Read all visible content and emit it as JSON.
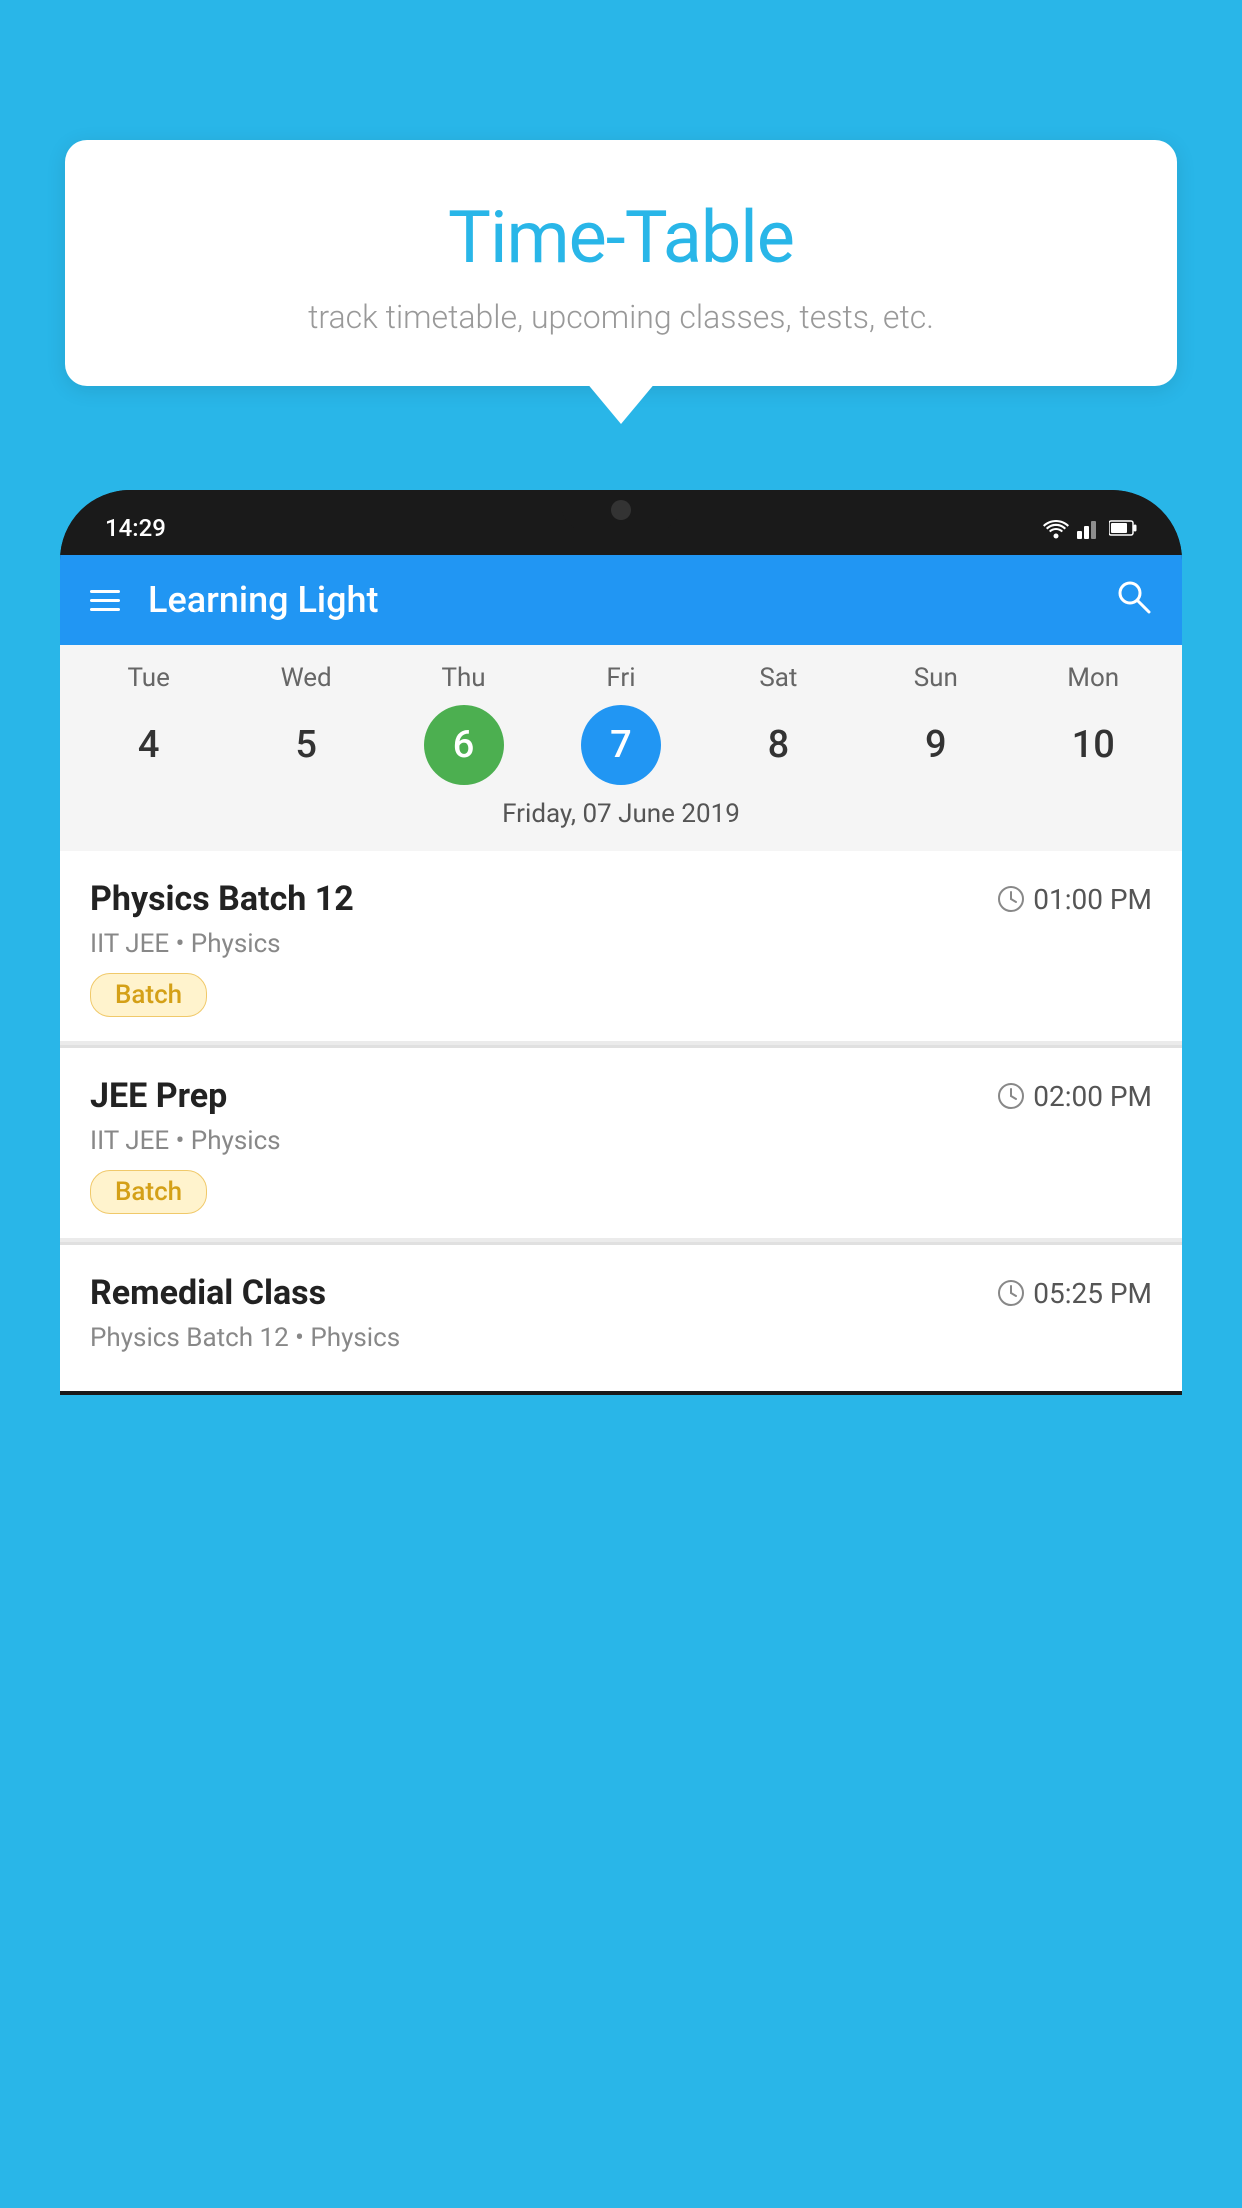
{
  "background_color": "#29B6E8",
  "bubble": {
    "title": "Time-Table",
    "subtitle": "track timetable, upcoming classes, tests, etc."
  },
  "status_bar": {
    "time": "14:29"
  },
  "app_header": {
    "title": "Learning Light",
    "menu_label": "menu",
    "search_label": "search"
  },
  "calendar": {
    "days": [
      {
        "label": "Tue",
        "num": "4"
      },
      {
        "label": "Wed",
        "num": "5"
      },
      {
        "label": "Thu",
        "num": "6",
        "state": "today"
      },
      {
        "label": "Fri",
        "num": "7",
        "state": "selected"
      },
      {
        "label": "Sat",
        "num": "8"
      },
      {
        "label": "Sun",
        "num": "9"
      },
      {
        "label": "Mon",
        "num": "10"
      }
    ],
    "selected_date_label": "Friday, 07 June 2019"
  },
  "schedule": {
    "items": [
      {
        "title": "Physics Batch 12",
        "time": "01:00 PM",
        "subtitle": "IIT JEE • Physics",
        "badge": "Batch"
      },
      {
        "title": "JEE Prep",
        "time": "02:00 PM",
        "subtitle": "IIT JEE • Physics",
        "badge": "Batch"
      },
      {
        "title": "Remedial Class",
        "time": "05:25 PM",
        "subtitle": "Physics Batch 12 • Physics",
        "badge": null
      }
    ]
  }
}
